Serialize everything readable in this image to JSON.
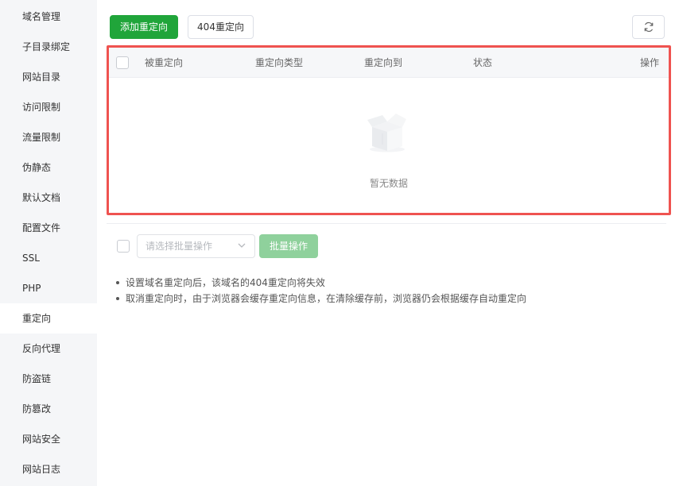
{
  "sidebar": {
    "items": [
      {
        "label": "域名管理"
      },
      {
        "label": "子目录绑定"
      },
      {
        "label": "网站目录"
      },
      {
        "label": "访问限制"
      },
      {
        "label": "流量限制"
      },
      {
        "label": "伪静态"
      },
      {
        "label": "默认文档"
      },
      {
        "label": "配置文件"
      },
      {
        "label": "SSL"
      },
      {
        "label": "PHP"
      },
      {
        "label": "重定向"
      },
      {
        "label": "反向代理"
      },
      {
        "label": "防盗链"
      },
      {
        "label": "防篡改"
      },
      {
        "label": "网站安全"
      },
      {
        "label": "网站日志"
      }
    ],
    "active_label": "重定向"
  },
  "toolbar": {
    "add_redirect_label": "添加重定向",
    "redirect_404_label": "404重定向",
    "refresh_icon": "refresh-icon"
  },
  "table": {
    "columns": [
      "被重定向",
      "重定向类型",
      "重定向到",
      "状态",
      "操作"
    ],
    "rows": [],
    "empty_text": "暂无数据",
    "highlight_color": "#ef5350"
  },
  "batch": {
    "select_placeholder": "请选择批量操作",
    "button_label": "批量操作"
  },
  "tips": [
    "设置域名重定向后，该域名的404重定向将失效",
    "取消重定向时，由于浏览器会缓存重定向信息，在清除缓存前，浏览器仍会根据缓存自动重定向"
  ],
  "colors": {
    "primary": "#20a53a",
    "primary_disabled": "#8fd19c",
    "sidebar_bg": "#f5f6f8"
  }
}
